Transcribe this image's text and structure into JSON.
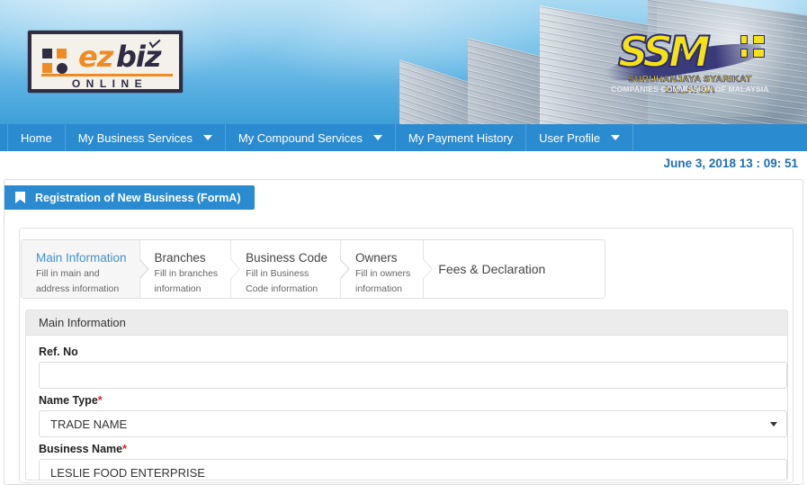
{
  "banner": {
    "logo": {
      "ez": "ez",
      "biz": "biz",
      "online": "ONLINE",
      "alt": "ezbiz-online-logo"
    },
    "ssm": {
      "mark": "SSM",
      "line1": "SURUHANJAYA SYARIKAT MALAYSIA",
      "line2": "COMPANIES COMMISSION OF MALAYSIA"
    }
  },
  "nav": {
    "items": [
      {
        "label": "Home",
        "has_caret": false
      },
      {
        "label": "My Business Services",
        "has_caret": true
      },
      {
        "label": "My Compound Services",
        "has_caret": true
      },
      {
        "label": "My Payment History",
        "has_caret": false
      },
      {
        "label": "User Profile",
        "has_caret": true
      }
    ]
  },
  "datetime": "June 3, 2018 13 : 09: 51",
  "page": {
    "title": "Registration of New Business (FormA)",
    "title_icon": "bookmark-icon"
  },
  "wizard": {
    "steps": [
      {
        "title": "Main Information",
        "sub1": "Fill in main and",
        "sub2": "address information",
        "active": true
      },
      {
        "title": "Branches",
        "sub1": "Fill in branches",
        "sub2": "information",
        "active": false
      },
      {
        "title": "Business Code",
        "sub1": "Fill in Business",
        "sub2": "Code information",
        "active": false
      },
      {
        "title": "Owners",
        "sub1": "Fill in owners",
        "sub2": "information",
        "active": false
      },
      {
        "title": "Fees & Declaration",
        "sub1": "",
        "sub2": "",
        "active": false
      }
    ]
  },
  "panel": {
    "heading": "Main Information",
    "fields": [
      {
        "label": "Ref. No",
        "required": false,
        "value": "",
        "type": "text"
      },
      {
        "label": "Name Type",
        "required": true,
        "value": "TRADE NAME",
        "type": "select"
      },
      {
        "label": "Business Name",
        "required": true,
        "value": "LESLIE FOOD ENTERPRISE",
        "type": "text"
      }
    ]
  },
  "colors": {
    "nav_blue": "#2b8bd0",
    "badge_blue": "#2b8bd0",
    "date_blue": "#1f6fb2",
    "active_tab_text": "#4290cc",
    "required_red": "#e02020",
    "logo_orange": "#ef8b22",
    "logo_dark": "#2f2c44",
    "ssm_yellow": "#f5e215",
    "ssm_navy": "#2b2b74"
  }
}
